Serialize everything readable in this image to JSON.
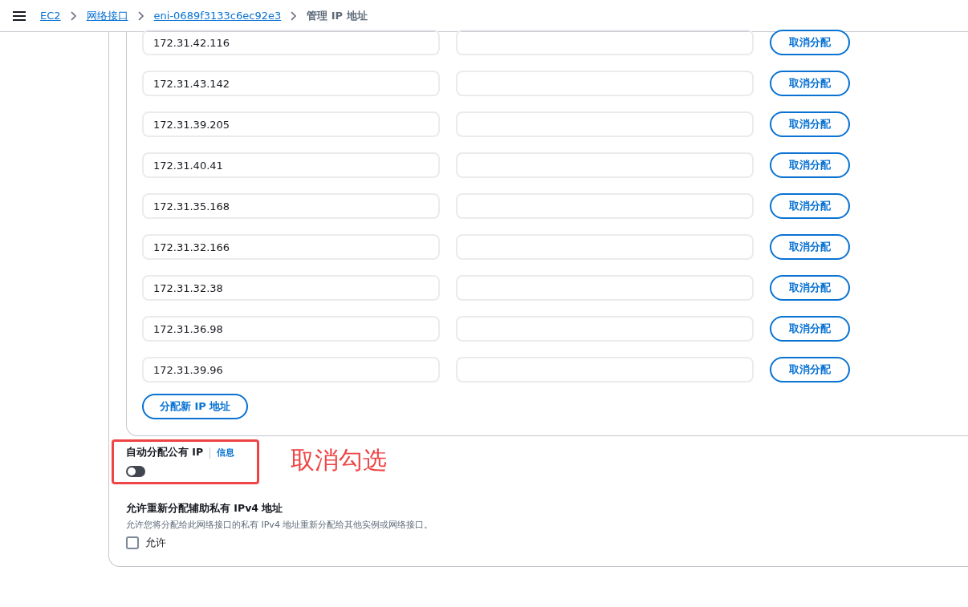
{
  "breadcrumbs": [
    {
      "label": "EC2",
      "kind": "link"
    },
    {
      "label": "网络接口",
      "kind": "link"
    },
    {
      "label": "eni-0689f3133c6ec92e3",
      "kind": "link"
    },
    {
      "label": "管理 IP 地址",
      "kind": "current"
    }
  ],
  "ip_rows": [
    {
      "address": "172.31.42.116",
      "button": "取消分配"
    },
    {
      "address": "172.31.43.142",
      "button": "取消分配"
    },
    {
      "address": "172.31.39.205",
      "button": "取消分配"
    },
    {
      "address": "172.31.40.41",
      "button": "取消分配"
    },
    {
      "address": "172.31.35.168",
      "button": "取消分配"
    },
    {
      "address": "172.31.32.166",
      "button": "取消分配"
    },
    {
      "address": "172.31.32.38",
      "button": "取消分配"
    },
    {
      "address": "172.31.36.98",
      "button": "取消分配"
    },
    {
      "address": "172.31.39.96",
      "button": "取消分配"
    }
  ],
  "assign_button": "分配新 IP 地址",
  "auto_public_ip": {
    "label": "自动分配公有 IP",
    "info": "信息",
    "on": false
  },
  "annotation": "取消勾选",
  "reassign": {
    "title": "允许重新分配辅助私有 IPv4 地址",
    "description": "允许您将分配给此网络接口的私有 IPv4 地址重新分配给其他实例或网络接口。",
    "checkbox_label": "允许",
    "checked": false
  }
}
